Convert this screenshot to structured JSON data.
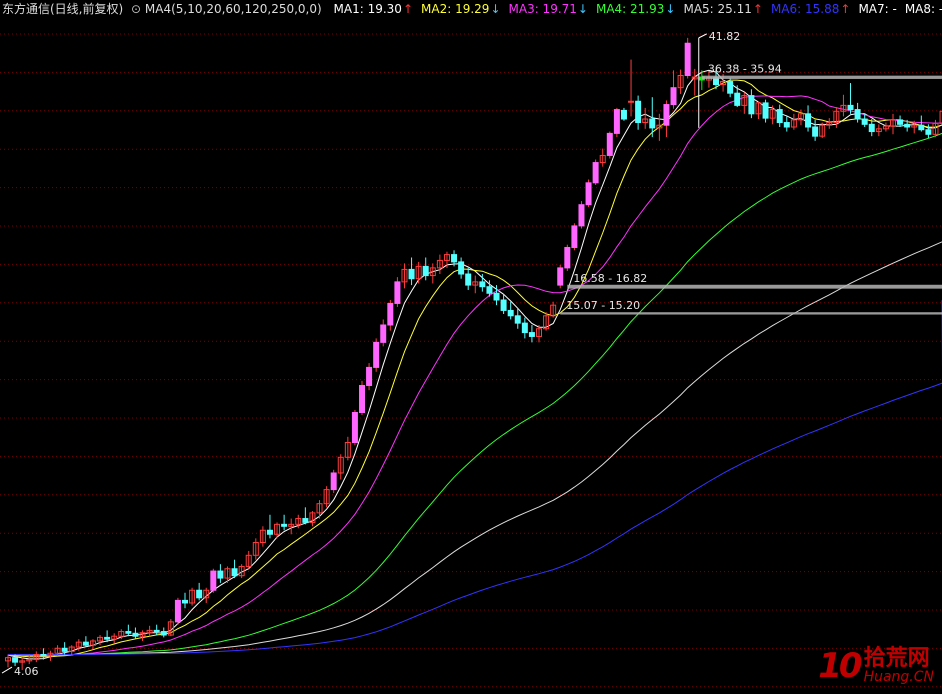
{
  "header": {
    "title": "东方通信(日线,前复权)",
    "setting_icon": "chevron-down-circle-icon",
    "setting": "MA4(5,10,20,60,120,250,0,0)",
    "ma_items": [
      {
        "label": "MA1: 19.30",
        "arrow": "↑",
        "dir": "up",
        "color": "#ffffff"
      },
      {
        "label": "MA2: 19.29",
        "arrow": "↓",
        "dir": "down",
        "color": "#ffff33"
      },
      {
        "label": "MA3: 19.71",
        "arrow": "↓",
        "dir": "down",
        "color": "#ff33ff"
      },
      {
        "label": "MA4: 21.93",
        "arrow": "↓",
        "dir": "down",
        "color": "#33ff33"
      },
      {
        "label": "MA5: 25.11",
        "arrow": "↑",
        "dir": "up",
        "color": "#dcdcdc"
      },
      {
        "label": "MA6: 15.88",
        "arrow": "↑",
        "dir": "up",
        "color": "#3333ff"
      },
      {
        "label": "MA7: -",
        "arrow": "",
        "dir": "",
        "color": "#ffffff"
      },
      {
        "label": "MA8: -",
        "arrow": "",
        "dir": "",
        "color": "#ffffff"
      }
    ]
  },
  "watermark": {
    "logo": "10",
    "cn": "拾荒网",
    "url": "Huang.CN"
  },
  "chart_data": {
    "type": "candlestick",
    "title": "东方通信(日线,前复权)",
    "ylim": [
      3.8,
      45
    ],
    "grid": true,
    "colors": {
      "up": "#ff3c3c",
      "down": "#54ffff",
      "up_fill": "#ff66ff",
      "highlight_down": "#00ff00",
      "ma1": "#ffffff",
      "ma2": "#ffff33",
      "ma3": "#ff33ff",
      "ma4": "#33ff33",
      "ma5": "#dcdcdc",
      "ma6": "#3333ff"
    },
    "annotations": [
      {
        "text": "41.82",
        "value": 41.82,
        "kind": "high"
      },
      {
        "text": "4.06",
        "value": 4.06,
        "kind": "low"
      },
      {
        "text": "36.38 - 35.94",
        "from": 36.38,
        "to": 35.94,
        "kind": "gap"
      },
      {
        "text": "16.58 - 16.82",
        "from": 16.58,
        "to": 16.82,
        "kind": "gap"
      },
      {
        "text": "15.07 - 15.20",
        "from": 15.07,
        "to": 15.2,
        "kind": "gap"
      }
    ],
    "candles": [
      [
        4.2,
        4.3,
        4.1,
        4.25
      ],
      [
        4.25,
        4.3,
        4.12,
        4.18
      ],
      [
        4.18,
        4.25,
        4.06,
        4.2
      ],
      [
        4.2,
        4.3,
        4.15,
        4.22
      ],
      [
        4.22,
        4.35,
        4.18,
        4.3
      ],
      [
        4.3,
        4.4,
        4.22,
        4.28
      ],
      [
        4.28,
        4.36,
        4.2,
        4.32
      ],
      [
        4.32,
        4.45,
        4.28,
        4.4
      ],
      [
        4.4,
        4.5,
        4.3,
        4.35
      ],
      [
        4.35,
        4.45,
        4.28,
        4.42
      ],
      [
        4.42,
        4.55,
        4.36,
        4.5
      ],
      [
        4.5,
        4.6,
        4.42,
        4.45
      ],
      [
        4.45,
        4.55,
        4.38,
        4.52
      ],
      [
        4.52,
        4.62,
        4.45,
        4.58
      ],
      [
        4.58,
        4.7,
        4.5,
        4.55
      ],
      [
        4.55,
        4.65,
        4.48,
        4.6
      ],
      [
        4.6,
        4.72,
        4.55,
        4.68
      ],
      [
        4.68,
        4.8,
        4.6,
        4.65
      ],
      [
        4.65,
        4.75,
        4.55,
        4.6
      ],
      [
        4.6,
        4.7,
        4.52,
        4.66
      ],
      [
        4.66,
        4.78,
        4.6,
        4.7
      ],
      [
        4.7,
        4.8,
        4.62,
        4.68
      ],
      [
        4.68,
        4.75,
        4.58,
        4.62
      ],
      [
        4.62,
        4.9,
        4.6,
        4.85
      ],
      [
        4.85,
        5.3,
        4.8,
        5.25
      ],
      [
        5.25,
        5.4,
        5.1,
        5.2
      ],
      [
        5.2,
        5.5,
        5.15,
        5.45
      ],
      [
        5.45,
        5.6,
        5.25,
        5.3
      ],
      [
        5.3,
        5.5,
        5.2,
        5.45
      ],
      [
        5.45,
        5.9,
        5.4,
        5.85
      ],
      [
        5.85,
        6.0,
        5.6,
        5.7
      ],
      [
        5.7,
        5.95,
        5.6,
        5.9
      ],
      [
        5.9,
        6.1,
        5.7,
        5.75
      ],
      [
        5.75,
        6.0,
        5.7,
        5.95
      ],
      [
        5.95,
        6.3,
        5.9,
        6.2
      ],
      [
        6.2,
        6.6,
        6.1,
        6.5
      ],
      [
        6.5,
        6.9,
        6.4,
        6.8
      ],
      [
        6.8,
        7.2,
        6.6,
        6.7
      ],
      [
        6.7,
        7.0,
        6.6,
        6.95
      ],
      [
        6.95,
        7.2,
        6.8,
        6.9
      ],
      [
        6.9,
        7.1,
        6.7,
        6.95
      ],
      [
        6.95,
        7.2,
        6.85,
        7.1
      ],
      [
        7.1,
        7.4,
        6.95,
        7.0
      ],
      [
        7.0,
        7.3,
        6.9,
        7.25
      ],
      [
        7.25,
        7.6,
        7.1,
        7.5
      ],
      [
        7.5,
        8.0,
        7.4,
        7.9
      ],
      [
        7.9,
        8.5,
        7.8,
        8.4
      ],
      [
        8.4,
        9.0,
        8.2,
        8.9
      ],
      [
        8.9,
        9.6,
        8.8,
        9.4
      ],
      [
        9.4,
        10.6,
        9.3,
        10.5
      ],
      [
        10.5,
        11.8,
        10.4,
        11.6
      ],
      [
        11.6,
        12.6,
        11.4,
        12.4
      ],
      [
        12.4,
        13.8,
        12.2,
        13.6
      ],
      [
        13.6,
        14.8,
        13.4,
        14.5
      ],
      [
        14.5,
        15.9,
        14.2,
        15.7
      ],
      [
        15.7,
        17.3,
        15.5,
        17.0
      ],
      [
        17.0,
        18.2,
        16.6,
        17.8
      ],
      [
        17.8,
        18.6,
        16.8,
        17.2
      ],
      [
        17.2,
        18.3,
        16.9,
        18.0
      ],
      [
        18.0,
        18.6,
        17.1,
        17.4
      ],
      [
        17.4,
        18.2,
        16.9,
        17.9
      ],
      [
        17.9,
        18.8,
        17.5,
        18.4
      ],
      [
        18.4,
        19.0,
        17.9,
        18.8
      ],
      [
        18.8,
        19.1,
        18.0,
        18.3
      ],
      [
        18.3,
        18.6,
        17.2,
        17.5
      ],
      [
        17.5,
        17.9,
        16.5,
        16.8
      ],
      [
        16.8,
        17.4,
        16.3,
        17.0
      ],
      [
        17.0,
        17.5,
        16.4,
        16.7
      ],
      [
        16.7,
        17.1,
        16.1,
        16.3
      ],
      [
        16.3,
        16.8,
        15.6,
        15.9
      ],
      [
        15.9,
        16.2,
        15.1,
        15.3
      ],
      [
        15.3,
        15.8,
        14.8,
        15.0
      ],
      [
        15.0,
        15.4,
        14.3,
        14.6
      ],
      [
        14.6,
        14.9,
        13.8,
        14.1
      ],
      [
        14.1,
        14.5,
        13.6,
        13.9
      ],
      [
        13.9,
        14.5,
        13.6,
        14.3
      ],
      [
        14.3,
        15.2,
        14.2,
        15.0
      ],
      [
        15.0,
        15.8,
        14.9,
        15.6
      ],
      [
        16.8,
        18.1,
        16.6,
        17.9
      ],
      [
        17.9,
        19.5,
        17.7,
        19.3
      ],
      [
        19.3,
        21.1,
        19.1,
        20.9
      ],
      [
        20.9,
        22.9,
        20.7,
        22.6
      ],
      [
        22.6,
        24.8,
        22.4,
        24.5
      ],
      [
        24.5,
        26.7,
        24.3,
        26.4
      ],
      [
        26.4,
        27.8,
        26.0,
        27.1
      ],
      [
        27.1,
        29.6,
        26.8,
        29.4
      ],
      [
        29.4,
        32.3,
        29.0,
        32.1
      ],
      [
        32.0,
        32.3,
        30.8,
        31.0
      ],
      [
        33.0,
        38.6,
        31.3,
        33.1
      ],
      [
        33.1,
        33.8,
        29.8,
        30.6
      ],
      [
        30.6,
        32.3,
        29.9,
        31.0
      ],
      [
        31.0,
        33.6,
        29.0,
        30.0
      ],
      [
        30.0,
        31.6,
        28.6,
        30.3
      ],
      [
        30.3,
        33.2,
        29.0,
        32.7
      ],
      [
        32.7,
        37.1,
        32.2,
        34.8
      ],
      [
        34.8,
        37.2,
        34.0,
        36.4
      ],
      [
        36.4,
        41.82,
        36.0,
        41.0
      ],
      [
        35.94,
        37.3,
        33.8,
        36.2
      ],
      [
        36.2,
        37.1,
        34.5,
        35.8
      ],
      [
        35.8,
        37.0,
        34.8,
        36.1
      ],
      [
        36.1,
        37.2,
        34.6,
        35.2
      ],
      [
        35.2,
        36.6,
        34.3,
        35.6
      ],
      [
        35.6,
        36.1,
        33.6,
        34.1
      ],
      [
        34.1,
        35.1,
        32.4,
        32.6
      ],
      [
        32.6,
        34.2,
        31.6,
        33.8
      ],
      [
        33.8,
        34.6,
        31.1,
        31.6
      ],
      [
        31.6,
        33.1,
        31.0,
        32.9
      ],
      [
        32.9,
        33.3,
        30.6,
        31.1
      ],
      [
        31.1,
        32.6,
        30.4,
        32.1
      ],
      [
        32.1,
        32.7,
        30.1,
        30.6
      ],
      [
        30.6,
        31.3,
        29.6,
        30.1
      ],
      [
        30.1,
        31.6,
        29.8,
        30.9
      ],
      [
        30.9,
        32.1,
        30.3,
        31.6
      ],
      [
        31.6,
        32.6,
        29.6,
        30.1
      ],
      [
        30.1,
        30.9,
        28.6,
        29.1
      ],
      [
        29.1,
        30.6,
        28.9,
        30.3
      ],
      [
        30.3,
        31.1,
        29.9,
        30.6
      ],
      [
        30.6,
        32.4,
        30.0,
        31.9
      ],
      [
        31.9,
        33.9,
        31.3,
        32.6
      ],
      [
        32.6,
        35.4,
        31.6,
        32.1
      ],
      [
        32.1,
        32.9,
        30.6,
        31.0
      ],
      [
        31.0,
        31.6,
        30.1,
        30.4
      ],
      [
        30.4,
        31.0,
        29.1,
        29.6
      ],
      [
        29.6,
        30.4,
        29.1,
        29.9
      ],
      [
        29.9,
        30.6,
        29.6,
        30.2
      ],
      [
        30.2,
        31.6,
        29.3,
        30.9
      ],
      [
        30.9,
        31.4,
        30.1,
        30.4
      ],
      [
        30.4,
        30.9,
        29.6,
        30.1
      ],
      [
        30.1,
        30.8,
        29.4,
        30.3
      ],
      [
        30.3,
        31.4,
        29.6,
        29.8
      ],
      [
        29.8,
        30.4,
        28.9,
        29.3
      ],
      [
        29.3,
        30.9,
        29.0,
        30.5
      ],
      [
        30.5,
        32.4,
        30.1,
        31.9
      ]
    ]
  }
}
